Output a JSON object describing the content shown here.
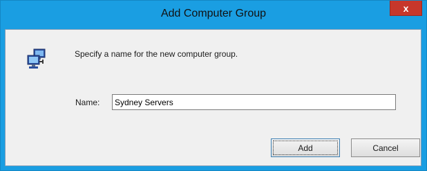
{
  "window": {
    "title": "Add Computer Group",
    "close_glyph": "x"
  },
  "dialog": {
    "icon": "computers-icon",
    "prompt": "Specify a name for the new computer group.",
    "name_label": "Name:",
    "name_value": "Sydney Servers"
  },
  "buttons": {
    "add_label": "Add",
    "cancel_label": "Cancel"
  },
  "colors": {
    "titlebar": "#1a9ee2",
    "close_button": "#c7372b",
    "client_bg": "#f0f0f0"
  }
}
